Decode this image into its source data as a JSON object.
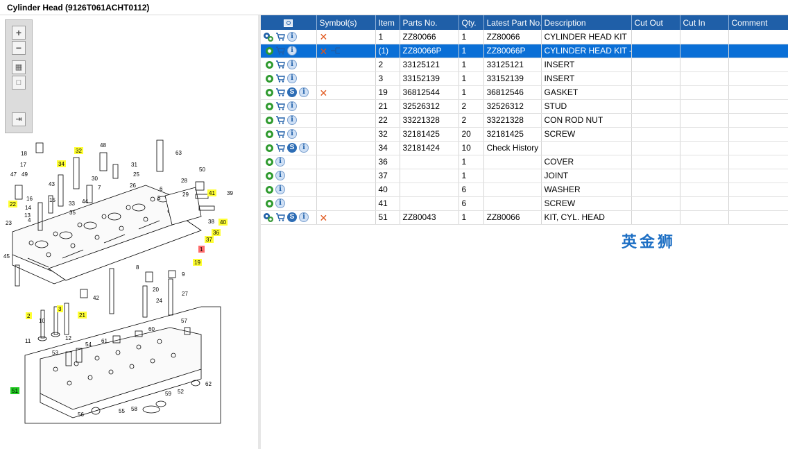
{
  "window": {
    "title": "Cylinder Head (9126T061ACHT0112)"
  },
  "toolbox": {
    "zoom_in": "+",
    "zoom_out": "−",
    "fit": "▦",
    "actual": "□",
    "export": "⇥"
  },
  "watermark": "英金狮",
  "diagram": {
    "labels": [
      "18",
      "17",
      "49",
      "47",
      "22",
      "23",
      "4",
      "45",
      "48",
      "32",
      "34",
      "16",
      "14",
      "13",
      "43",
      "33",
      "35",
      "44",
      "30",
      "7",
      "31",
      "25",
      "26",
      "6",
      "28",
      "5",
      "50",
      "29",
      "41",
      "39",
      "38",
      "40",
      "36",
      "37",
      "1",
      "19",
      "9",
      "8",
      "20",
      "42",
      "24",
      "27",
      "63",
      "15",
      "2",
      "3",
      "21",
      "11",
      "10",
      "12",
      "53",
      "54",
      "61",
      "60",
      "57",
      "51",
      "56",
      "55",
      "58",
      "59",
      "52",
      "62"
    ],
    "highlight_yellow": [
      "32",
      "34",
      "22",
      "41",
      "40",
      "36",
      "37",
      "19",
      "2",
      "3",
      "21"
    ],
    "highlight_red": [
      "1"
    ],
    "highlight_green": [
      "51"
    ]
  },
  "table": {
    "columns": [
      "",
      "Symbol(s)",
      "Item",
      "Parts No.",
      "Qty.",
      "Latest Part No.",
      "Description",
      "Cut Out",
      "Cut In",
      "Comment"
    ],
    "rows": [
      {
        "icons": [
          "gears",
          "cart",
          "info"
        ],
        "x": true,
        "arrow": false,
        "item": "1",
        "part": "ZZ80066",
        "qty": "1",
        "latest": "ZZ80066",
        "desc": "CYLINDER HEAD KIT",
        "cutout": "",
        "cutin": "",
        "comment": ""
      },
      {
        "icons": [
          "gear",
          "cart",
          "info"
        ],
        "x": true,
        "arrow": true,
        "item": "(1)",
        "part": "ZZ80066P",
        "qty": "1",
        "latest": "ZZ80066P",
        "desc": "CYLINDER HEAD KIT - EXCHANGE",
        "cutout": "",
        "cutin": "",
        "comment": "",
        "selected": true
      },
      {
        "icons": [
          "gear",
          "cart",
          "info"
        ],
        "x": false,
        "arrow": false,
        "item": "2",
        "part": "33125121",
        "qty": "1",
        "latest": "33125121",
        "desc": "INSERT",
        "cutout": "",
        "cutin": "",
        "comment": ""
      },
      {
        "icons": [
          "gear",
          "cart",
          "info"
        ],
        "x": false,
        "arrow": false,
        "item": "3",
        "part": "33152139",
        "qty": "1",
        "latest": "33152139",
        "desc": "INSERT",
        "cutout": "",
        "cutin": "",
        "comment": ""
      },
      {
        "icons": [
          "gear",
          "cart",
          "s",
          "info"
        ],
        "x": true,
        "arrow": false,
        "item": "19",
        "part": "36812544",
        "qty": "1",
        "latest": "36812546",
        "desc": "GASKET",
        "cutout": "",
        "cutin": "",
        "comment": ""
      },
      {
        "icons": [
          "gear",
          "cart",
          "info"
        ],
        "x": false,
        "arrow": false,
        "item": "21",
        "part": "32526312",
        "qty": "2",
        "latest": "32526312",
        "desc": "STUD",
        "cutout": "",
        "cutin": "",
        "comment": ""
      },
      {
        "icons": [
          "gear",
          "cart",
          "info"
        ],
        "x": false,
        "arrow": false,
        "item": "22",
        "part": "33221328",
        "qty": "2",
        "latest": "33221328",
        "desc": "CON ROD NUT",
        "cutout": "",
        "cutin": "",
        "comment": ""
      },
      {
        "icons": [
          "gear",
          "cart",
          "info"
        ],
        "x": false,
        "arrow": false,
        "item": "32",
        "part": "32181425",
        "qty": "20",
        "latest": "32181425",
        "desc": "SCREW",
        "cutout": "",
        "cutin": "",
        "comment": ""
      },
      {
        "icons": [
          "gear",
          "cart",
          "s",
          "info"
        ],
        "x": false,
        "arrow": false,
        "item": "34",
        "part": "32181424",
        "qty": "10",
        "latest": "Check History",
        "desc": "",
        "cutout": "",
        "cutin": "",
        "comment": ""
      },
      {
        "icons": [
          "gear",
          "info"
        ],
        "x": false,
        "arrow": false,
        "item": "36",
        "part": "",
        "qty": "1",
        "latest": "",
        "desc": "COVER",
        "cutout": "",
        "cutin": "",
        "comment": ""
      },
      {
        "icons": [
          "gear",
          "info"
        ],
        "x": false,
        "arrow": false,
        "item": "37",
        "part": "",
        "qty": "1",
        "latest": "",
        "desc": "JOINT",
        "cutout": "",
        "cutin": "",
        "comment": ""
      },
      {
        "icons": [
          "gear",
          "info"
        ],
        "x": false,
        "arrow": false,
        "item": "40",
        "part": "",
        "qty": "6",
        "latest": "",
        "desc": "WASHER",
        "cutout": "",
        "cutin": "",
        "comment": ""
      },
      {
        "icons": [
          "gear",
          "info"
        ],
        "x": false,
        "arrow": false,
        "item": "41",
        "part": "",
        "qty": "6",
        "latest": "",
        "desc": "SCREW",
        "cutout": "",
        "cutin": "",
        "comment": ""
      },
      {
        "icons": [
          "gears",
          "cart",
          "s",
          "info"
        ],
        "x": true,
        "arrow": false,
        "item": "51",
        "part": "ZZ80043",
        "qty": "1",
        "latest": "ZZ80066",
        "desc": "KIT, CYL. HEAD",
        "cutout": "",
        "cutin": "",
        "comment": ""
      }
    ]
  },
  "colors": {
    "header": "#1f5fa8",
    "selected": "#0a6fd6",
    "x_mark": "#e0561b",
    "highlight_yellow": "#ffff33",
    "highlight_green": "#22cc22",
    "highlight_red": "#ff6b6b"
  }
}
